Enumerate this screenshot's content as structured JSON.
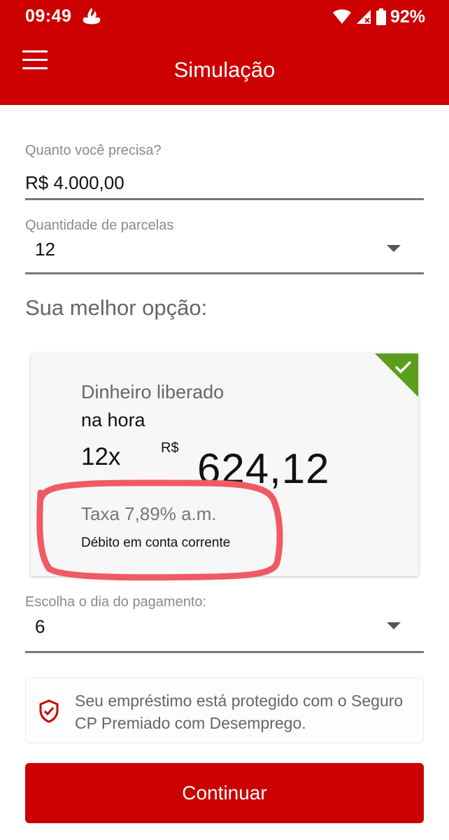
{
  "status_bar": {
    "time": "09:49",
    "battery": "92%",
    "icons": [
      "santander-flame-icon",
      "wifi-icon",
      "signal-icon",
      "battery-icon"
    ]
  },
  "header": {
    "title": "Simulação",
    "menu_icon": "hamburger-menu-icon",
    "background_color": "#cc0000"
  },
  "form": {
    "amount": {
      "label": "Quanto você precisa?",
      "value": "R$ 4.000,00"
    },
    "installments": {
      "label": "Quantidade de parcelas",
      "value": "12"
    }
  },
  "best_option": {
    "title": "Sua melhor opção:",
    "card": {
      "line1": "Dinheiro liberado",
      "line2": "na hora",
      "installments": "12x",
      "currency": "R$",
      "amount": "624,12",
      "rate": "Taxa 7,89% a.m.",
      "debit": "Débito em conta corrente",
      "selected_icon": "check-icon",
      "selected_color": "#5a9e1e"
    }
  },
  "payment_day": {
    "label": "Escolha o dia do pagamento:",
    "value": "6"
  },
  "insurance": {
    "icon": "shield-check-icon",
    "text": "Seu empréstimo está protegido com o Seguro CP Premiado com Desemprego."
  },
  "continue_button": {
    "label": "Continuar",
    "color": "#cc0000"
  },
  "annotation": {
    "color": "#f05a64"
  }
}
